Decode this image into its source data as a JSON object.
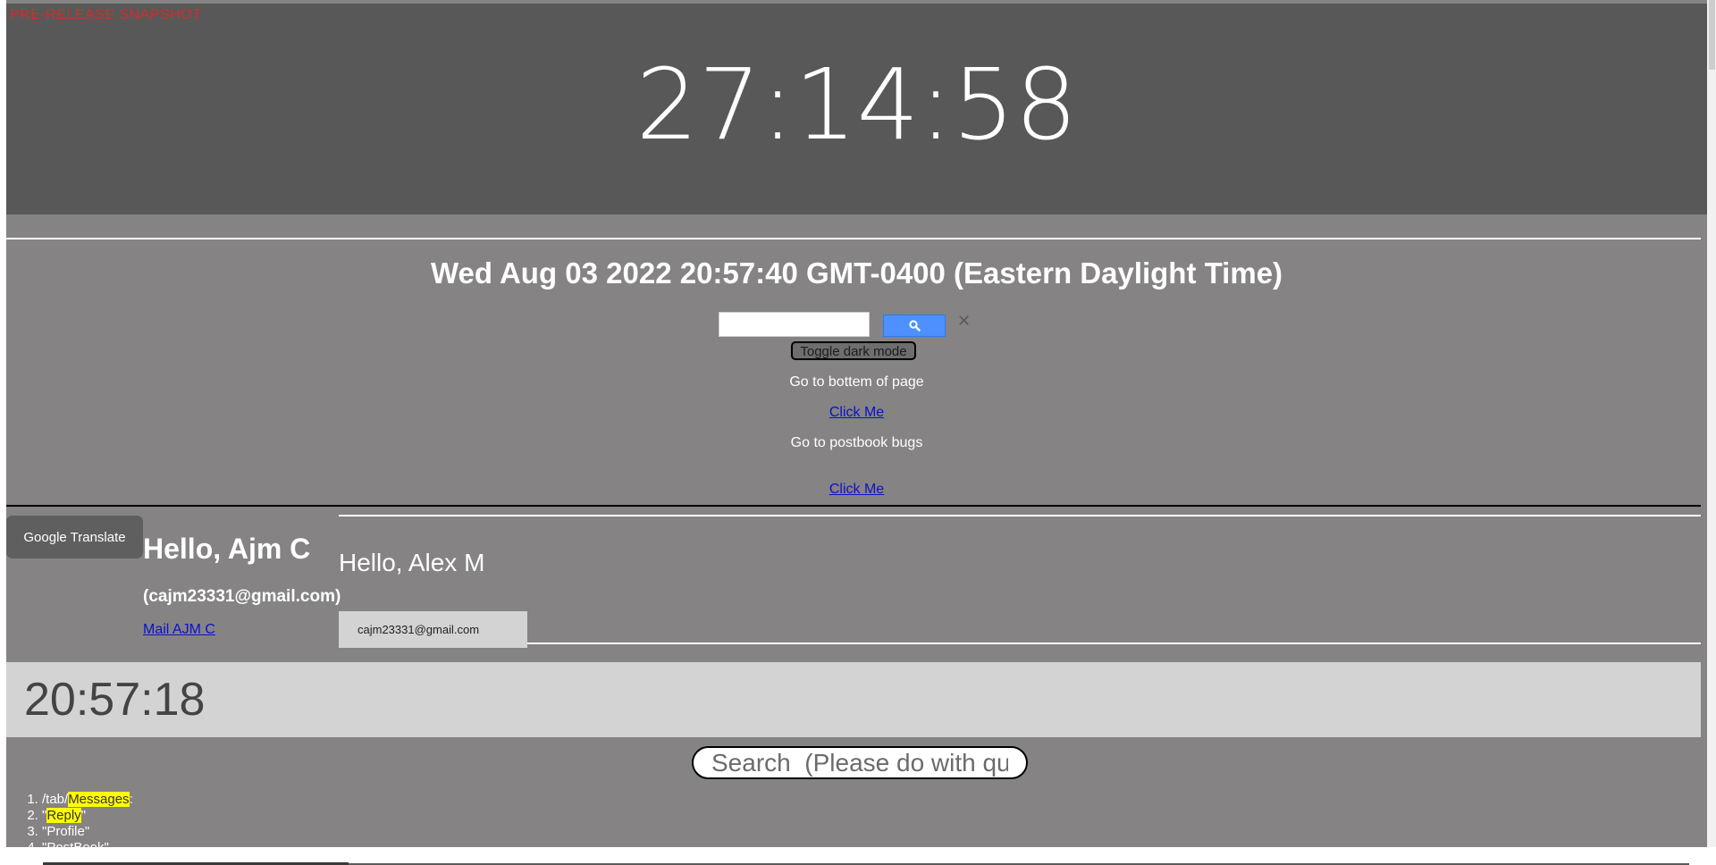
{
  "banner": {
    "prerelease_label": "PRE-RELEASE SNAPSHOT",
    "big_clock": "27:14:58"
  },
  "date_line": "Wed Aug 03 2022 20:57:40 GMT-0400 (Eastern Daylight Time)",
  "search": {
    "value": "",
    "button_icon": "search-icon",
    "clear_icon": "close-icon"
  },
  "toggle_dark_mode": "Toggle dark mode",
  "nav": {
    "bottom_label": "Go to bottem of page",
    "bottom_link": "Click Me",
    "postbook_label": "Go to postbook bugs",
    "postbook_link": "Click Me"
  },
  "translate_button": "Google Translate",
  "profile": {
    "hello": "Hello, Ajm C",
    "email": "(cajm23331@gmail.com)",
    "mail_link": "Mail AJM C"
  },
  "alex": {
    "hello": "Hello, Alex M",
    "email": "cajm23331@gmail.com"
  },
  "small_clock": "20:57:18",
  "search_bar": {
    "placeholder": "Search  (Please do with quotes)"
  },
  "results": [
    {
      "prefix": "/tab/",
      "highlight": "Messages",
      "suffix": ":"
    },
    {
      "prefix": "\"",
      "highlight": "Reply",
      "suffix": "\""
    },
    {
      "prefix": "\"Profile\"",
      "highlight": "",
      "suffix": ""
    },
    {
      "prefix": "\"PostBook\"",
      "highlight": "",
      "suffix": ""
    }
  ],
  "colors": {
    "page_bg": "#858384",
    "banner_bg": "#585858",
    "search_button": "#4d90fe",
    "highlight": "#ffff00",
    "link": "#0b11cc",
    "prerelease": "#d62b2b"
  }
}
